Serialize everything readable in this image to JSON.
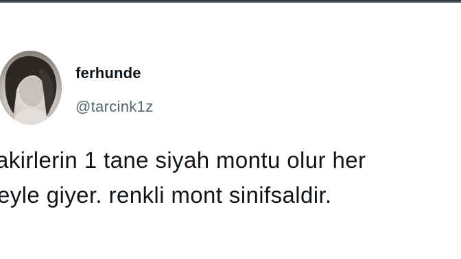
{
  "tweet": {
    "author": {
      "display_name": "ferhunde",
      "handle": "@tarcink1z",
      "avatar_icon": "profile-photo"
    },
    "text_lines": [
      "akirlerin 1 tane siyah montu olur her",
      "eyle giyer. renkli mont sinifsaldir."
    ]
  },
  "colors": {
    "background": "#ffffff",
    "primary_text": "#0f1419",
    "secondary_text": "#536471"
  }
}
